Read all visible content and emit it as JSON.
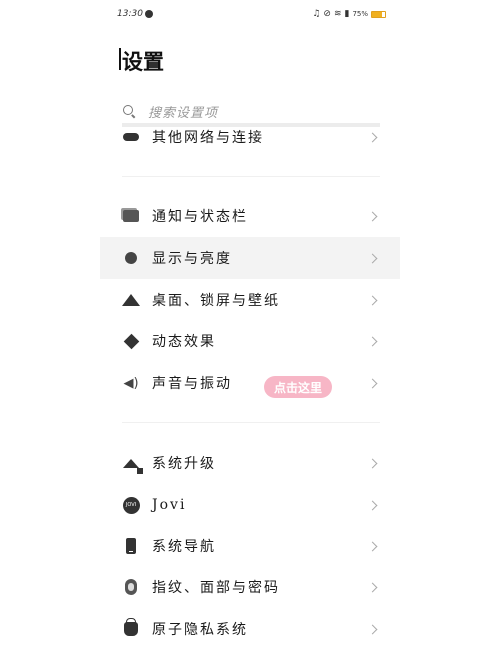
{
  "status_bar": {
    "time": "13:30",
    "battery_percent": "75%",
    "battery_level": 0.75
  },
  "page": {
    "title": "设置",
    "search_placeholder": "搜索设置项"
  },
  "colors": {
    "badge_bg": "#f7b6c6",
    "highlight_row": "#f3f3f3",
    "battery": "#f0b020"
  },
  "groups": [
    {
      "items": [
        {
          "label": "其他网络与连接",
          "icon": "link-icon"
        }
      ]
    },
    {
      "items": [
        {
          "label": "通知与状态栏",
          "icon": "notification-icon"
        },
        {
          "label": "显示与亮度",
          "icon": "display-icon"
        },
        {
          "label": "桌面、锁屏与壁纸",
          "icon": "mountain-icon"
        },
        {
          "label": "动态效果",
          "icon": "diamond-icon"
        },
        {
          "label": "声音与振动",
          "icon": "speaker-icon"
        }
      ]
    },
    {
      "items": [
        {
          "label": "系统升级",
          "icon": "upgrade-arrow-icon"
        },
        {
          "label": "Jovi",
          "icon": "jovi-icon",
          "icon_text": "JOVI"
        },
        {
          "label": "系统导航",
          "icon": "phone-icon"
        },
        {
          "label": "指纹、面部与密码",
          "icon": "fingerprint-icon"
        },
        {
          "label": "原子隐私系统",
          "icon": "lock-icon"
        }
      ]
    }
  ],
  "badge": {
    "text": "点击这里"
  }
}
